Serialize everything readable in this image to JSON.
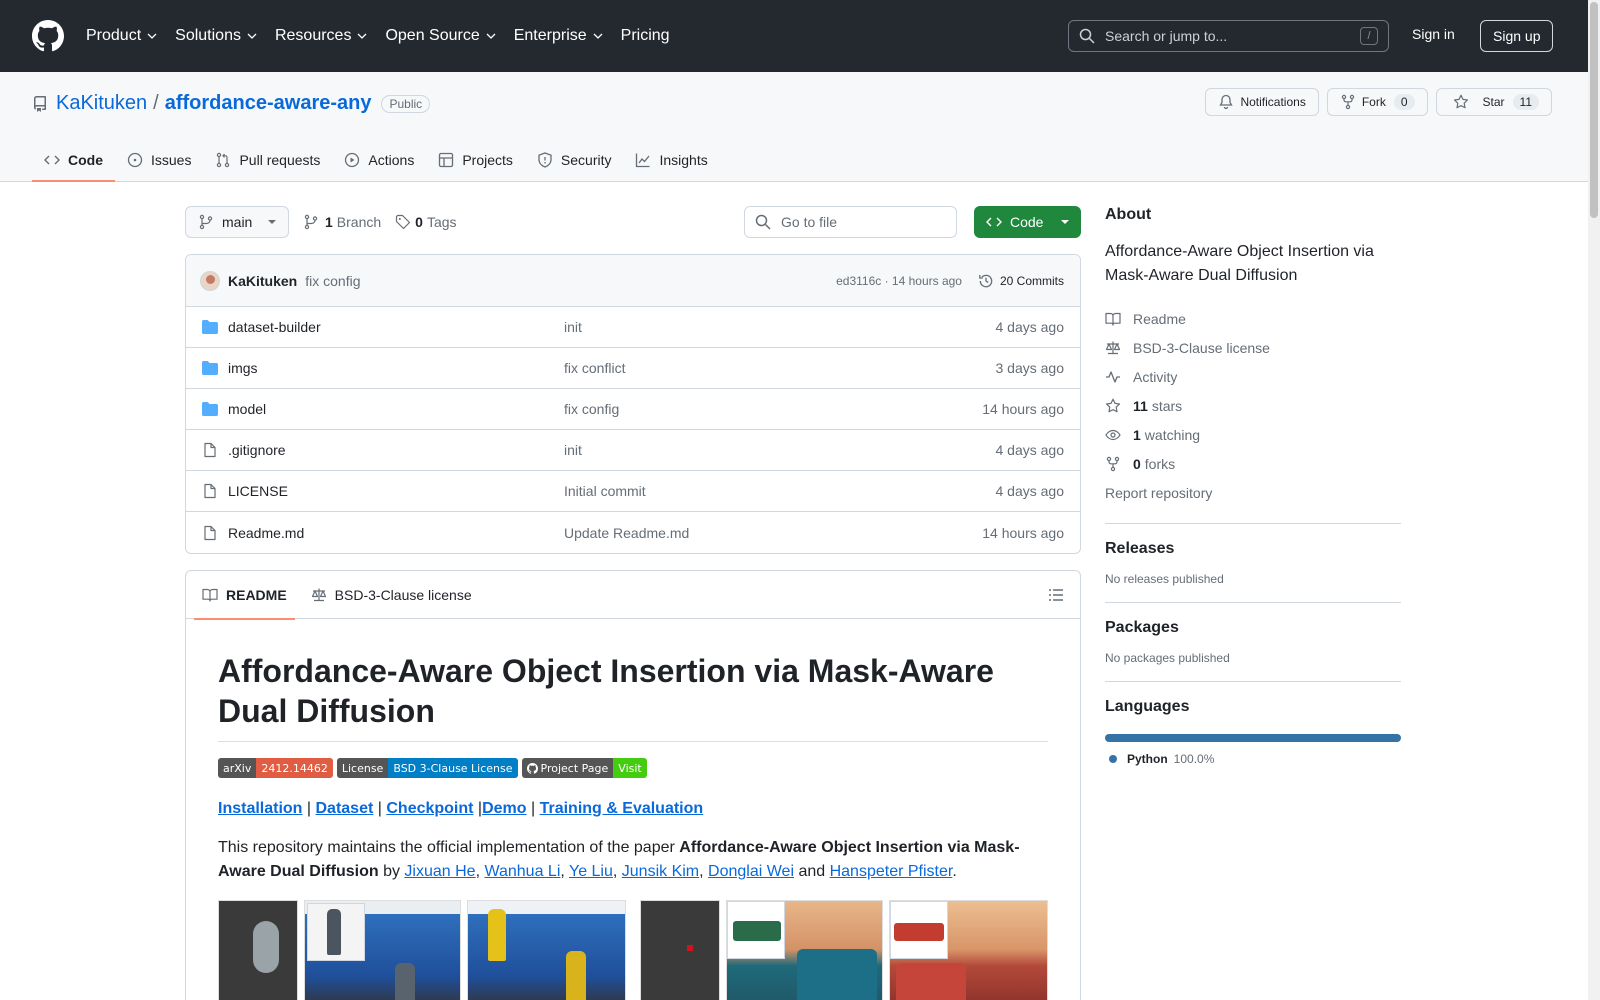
{
  "header": {
    "nav": [
      {
        "label": "Product"
      },
      {
        "label": "Solutions"
      },
      {
        "label": "Resources"
      },
      {
        "label": "Open Source"
      },
      {
        "label": "Enterprise"
      },
      {
        "label": "Pricing"
      }
    ],
    "search_placeholder": "Search or jump to...",
    "search_shortcut": "/",
    "sign_in": "Sign in",
    "sign_up": "Sign up"
  },
  "repo": {
    "owner": "KaKituken",
    "separator": "/",
    "name": "affordance-aware-any",
    "visibility": "Public",
    "notifications_label": "Notifications",
    "fork_label": "Fork",
    "fork_count": "0",
    "star_label": "Star",
    "star_count": "11",
    "tabs": [
      {
        "label": "Code",
        "icon": "code-icon"
      },
      {
        "label": "Issues",
        "icon": "issue-icon"
      },
      {
        "label": "Pull requests",
        "icon": "pull-request-icon"
      },
      {
        "label": "Actions",
        "icon": "play-icon"
      },
      {
        "label": "Projects",
        "icon": "table-icon"
      },
      {
        "label": "Security",
        "icon": "shield-icon"
      },
      {
        "label": "Insights",
        "icon": "graph-icon"
      }
    ]
  },
  "filenav": {
    "branch": "main",
    "branch_count": "1",
    "branch_label": "Branch",
    "tag_count": "0",
    "tag_label": "Tags",
    "goto_placeholder": "Go to file",
    "code_button": "Code"
  },
  "latest_commit": {
    "author": "KaKituken",
    "message": "fix config",
    "meta": "ed3116c · 14 hours ago",
    "commits": "20 Commits"
  },
  "files": [
    {
      "name": "dataset-builder",
      "type": "folder",
      "message": "init",
      "date": "4 days ago"
    },
    {
      "name": "imgs",
      "type": "folder",
      "message": "fix conflict",
      "date": "3 days ago"
    },
    {
      "name": "model",
      "type": "folder",
      "message": "fix config",
      "date": "14 hours ago"
    },
    {
      "name": ".gitignore",
      "type": "file",
      "message": "init",
      "date": "4 days ago"
    },
    {
      "name": "LICENSE",
      "type": "file",
      "message": "Initial commit",
      "date": "4 days ago"
    },
    {
      "name": "Readme.md",
      "type": "file",
      "message": "Update Readme.md",
      "date": "14 hours ago"
    }
  ],
  "readme": {
    "tab_readme": "README",
    "tab_license": "BSD-3-Clause license",
    "title": "Affordance-Aware Object Insertion via Mask-Aware Dual Diffusion",
    "shields": [
      {
        "left": "arXiv",
        "right": "2412.14462",
        "color": "#e05d44"
      },
      {
        "left": "License",
        "right": "BSD 3-Clause License",
        "color": "#007ec6"
      },
      {
        "left": "Project Page",
        "right": "Visit",
        "color": "#4c1"
      }
    ],
    "links": {
      "installation": "Installation",
      "sep1": " | ",
      "dataset": "Dataset",
      "sep2": " | ",
      "checkpoint": "Checkpoint",
      "sep3": " |",
      "demo": "Demo",
      "sep4": " | ",
      "training": "Training & Evaluation"
    },
    "para": {
      "prefix": "This repository maintains the official implementation of the paper ",
      "bold": "Affordance-Aware Object Insertion via Mask-Aware Dual Diffusion",
      "by": " by ",
      "authors": [
        "Jixuan He",
        "Wanhua Li",
        "Ye Liu",
        "Junsik Kim",
        "Donglai Wei"
      ],
      "comma": ", ",
      "and": " and ",
      "last_author": "Hanspeter Pfister",
      "period": "."
    }
  },
  "about": {
    "heading": "About",
    "description": "Affordance-Aware Object Insertion via Mask-Aware Dual Diffusion",
    "readme": "Readme",
    "license": "BSD-3-Clause license",
    "activity": "Activity",
    "stars_count": "11",
    "stars_label": "stars",
    "watching_count": "1",
    "watching_label": "watching",
    "forks_count": "0",
    "forks_label": "forks",
    "report": "Report repository"
  },
  "releases": {
    "heading": "Releases",
    "text": "No releases published"
  },
  "packages": {
    "heading": "Packages",
    "text": "No packages published"
  },
  "languages": {
    "heading": "Languages",
    "name": "Python",
    "percent": "100.0%",
    "color": "#3572a5"
  }
}
